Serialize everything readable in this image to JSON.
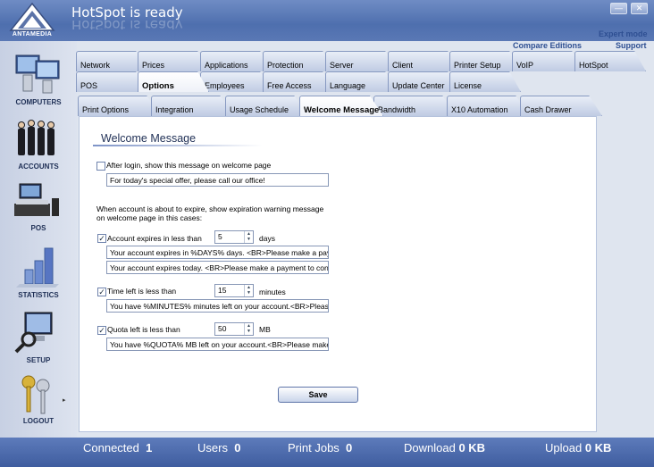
{
  "window": {
    "title": "HotSpot is ready",
    "logo_text": "ANTAMEDIA",
    "minimize_symbol": "—",
    "close_symbol": "✕"
  },
  "links": {
    "expert_mode": "Expert mode",
    "compare_editions": "Compare Editions",
    "support": "Support"
  },
  "sidebar": {
    "items": [
      {
        "label": "COMPUTERS",
        "icon": "computers-icon"
      },
      {
        "label": "ACCOUNTS",
        "icon": "accounts-icon"
      },
      {
        "label": "POS",
        "icon": "pos-icon"
      },
      {
        "label": "STATISTICS",
        "icon": "statistics-icon"
      },
      {
        "label": "SETUP",
        "icon": "setup-icon"
      },
      {
        "label": "LOGOUT",
        "icon": "keys-icon"
      }
    ],
    "logout_arrow": "▸"
  },
  "tabs": {
    "row1": [
      "Network",
      "Prices",
      "Applications",
      "Protection",
      "Server",
      "Client",
      "Printer Setup",
      "VoIP",
      "HotSpot"
    ],
    "row2": [
      "POS",
      "Options",
      "Employees",
      "Free Access",
      "Language",
      "Update Center",
      "License"
    ],
    "row3": [
      "Print Options",
      "Integration",
      "Usage Schedule",
      "Welcome Message",
      "Bandwidth",
      "X10 Automation",
      "Cash Drawer"
    ],
    "active_row2": "Options",
    "active_row3": "Welcome Message"
  },
  "welcome": {
    "heading": "Welcome Message",
    "after_login_label": "After login, show this message on welcome page",
    "after_login_checked": false,
    "after_login_message": "For today's special offer, please call our office!",
    "expire_intro_line1": "When account is about to expire, show expiration warning message",
    "expire_intro_line2": "on welcome page in this cases:",
    "account_expires": {
      "label": "Account expires in less than",
      "checked": true,
      "value": "5",
      "unit": "days",
      "message1": "Your account expires in %DAYS% days. <BR>Please make a payme",
      "message2": "Your account expires today. <BR>Please make a payment to contin"
    },
    "time_left": {
      "label": "Time left is less than",
      "checked": true,
      "value": "15",
      "unit": "minutes",
      "message": "You have %MINUTES% minutes left on your account.<BR>Please m"
    },
    "quota_left": {
      "label": "Quota left is less than",
      "checked": true,
      "value": "50",
      "unit": "MB",
      "message": "You have %QUOTA% MB left on your account.<BR>Please make a"
    },
    "check_mark": "✓",
    "spin_up": "▲",
    "spin_down": "▼",
    "save_label": "Save"
  },
  "status": {
    "connected_label": "Connected",
    "connected_value": "1",
    "users_label": "Users",
    "users_value": "0",
    "print_jobs_label": "Print Jobs",
    "print_jobs_value": "0",
    "download_label": "Download",
    "download_value": "0 KB",
    "upload_label": "Upload",
    "upload_value": "0 KB"
  },
  "colors": {
    "titlebar": "#4e6fae",
    "accent_link": "#2e4f92",
    "statusbar": "#3f5d9f",
    "panel": "#ffffff"
  }
}
